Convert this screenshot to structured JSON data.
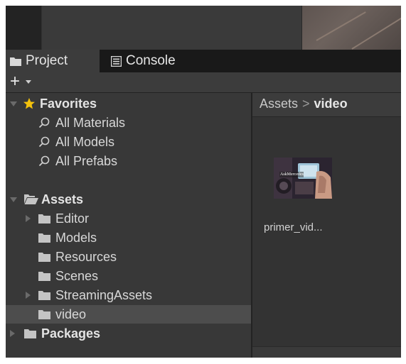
{
  "tabs": [
    {
      "label": "Project",
      "icon": "folder-icon",
      "active": true
    },
    {
      "label": "Console",
      "icon": "console-icon",
      "active": false
    }
  ],
  "toolbar": {
    "add_label": "+",
    "add_icon": "plus-icon"
  },
  "favorites": {
    "label": "Favorites",
    "icon": "star-icon",
    "items": [
      {
        "label": "All Materials",
        "icon": "search-icon"
      },
      {
        "label": "All Models",
        "icon": "search-icon"
      },
      {
        "label": "All Prefabs",
        "icon": "search-icon"
      }
    ]
  },
  "assets": {
    "label": "Assets",
    "icon": "folder-open-icon",
    "items": [
      {
        "label": "Editor",
        "expandable": true
      },
      {
        "label": "Models",
        "expandable": false
      },
      {
        "label": "Resources",
        "expandable": false
      },
      {
        "label": "Scenes",
        "expandable": false
      },
      {
        "label": "StreamingAssets",
        "expandable": true
      },
      {
        "label": "video",
        "expandable": false,
        "selected": true
      }
    ]
  },
  "packages": {
    "label": "Packages",
    "icon": "folder-icon"
  },
  "breadcrumb": {
    "root": "Assets",
    "separator": ">",
    "current": "video"
  },
  "asset_grid": [
    {
      "name": "primer_vid...",
      "thumbnail_text": "AskMercedes",
      "type": "video"
    }
  ],
  "colors": {
    "star": "#f4c20d",
    "folder": "#c4c4c4",
    "selection": "#4d4d4d"
  }
}
